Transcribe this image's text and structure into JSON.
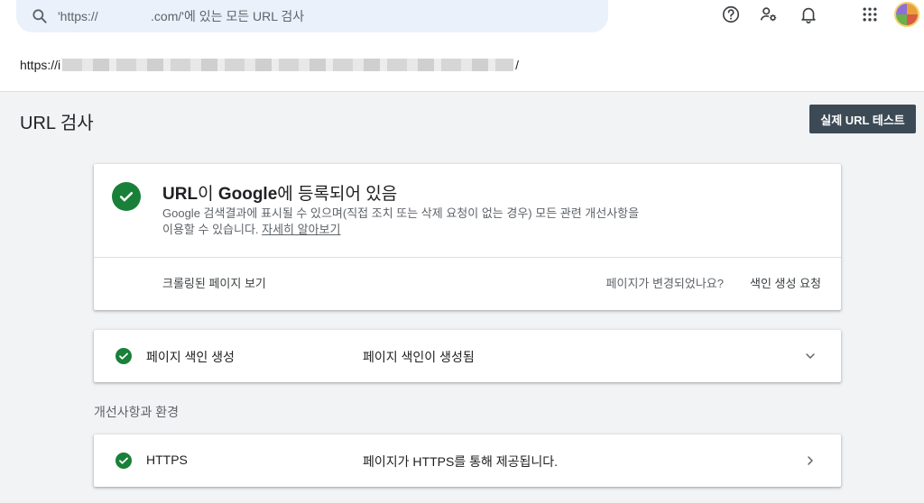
{
  "search": {
    "placeholder": "'https://               .com/'에 있는 모든 URL 검사",
    "icon": "search-icon"
  },
  "header_icons": [
    "help-icon",
    "manage-users-icon",
    "notifications-icon",
    "apps-grid-icon",
    "account-avatar"
  ],
  "inspected_url": {
    "prefix": "https://i",
    "suffix": "/"
  },
  "page": {
    "title": "URL 검사",
    "live_test_label": "실제 URL 테스트"
  },
  "main_card": {
    "headline_part1": "URL",
    "headline_part2": "이 ",
    "headline_part3": "Google",
    "headline_part4": "에 등록되어 있음",
    "description": "Google 검색결과에 표시될 수 있으며(직접 조치 또는 삭제 요청이 없는 경우) 모든 관련 개선사항을 이용할 수 있습니다. ",
    "learn_more": "자세히 알아보기",
    "crawled_page": "크롤링된 페이지 보기",
    "changed_question": "페이지가 변경되었나요?",
    "request_indexing": "색인 생성 요청"
  },
  "indexing_row": {
    "label": "페이지 색인 생성",
    "status": "페이지 색인이 생성됨"
  },
  "enhancements": {
    "section_label": "개선사항과 환경",
    "rows": [
      {
        "label": "HTTPS",
        "status": "페이지가 HTTPS를 통해 제공됩니다."
      }
    ]
  },
  "colors": {
    "success_green": "#188038",
    "button_dark": "#3c4a56",
    "search_bg": "#eaf1fb"
  }
}
